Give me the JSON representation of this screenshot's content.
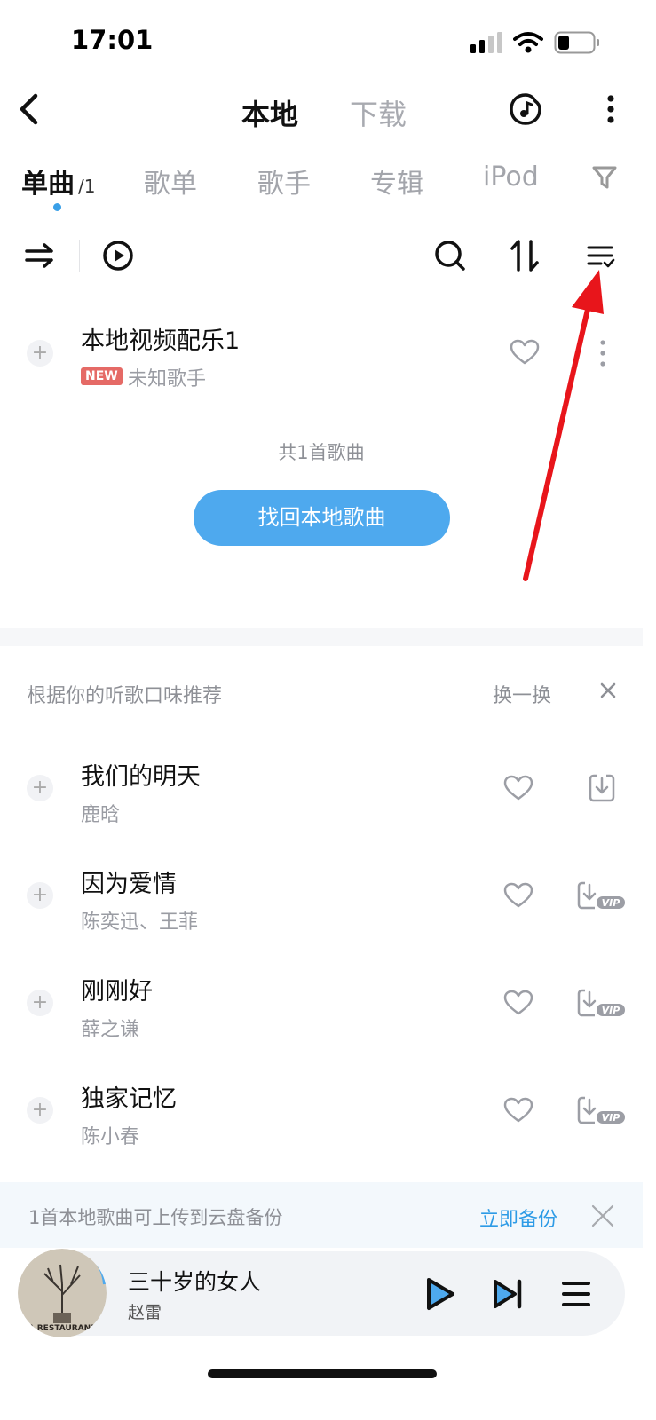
{
  "status_bar": {
    "time": "17:01"
  },
  "header": {
    "tab_local": "本地",
    "tab_download": "下载"
  },
  "tabs": {
    "songs": "单曲",
    "songs_count": "/1",
    "playlists": "歌单",
    "artists": "歌手",
    "albums": "专辑",
    "ipod": "iPod"
  },
  "local_songs": [
    {
      "title": "本地视频配乐1",
      "badge": "NEW",
      "artist": "未知歌手"
    }
  ],
  "total_count": "共1首歌曲",
  "recover_button": "找回本地歌曲",
  "recommend": {
    "title": "根据你的听歌口味推荐",
    "refresh": "换一换",
    "songs": [
      {
        "title": "我们的明天",
        "artist": "鹿晗",
        "download": "download-icon"
      },
      {
        "title": "因为爱情",
        "artist": "陈奕迅、王菲",
        "download": "vip-download-icon"
      },
      {
        "title": "刚刚好",
        "artist": "薛之谦",
        "download": "vip-download-icon"
      },
      {
        "title": "独家记忆",
        "artist": "陈小春",
        "download": "vip-download-icon"
      }
    ]
  },
  "backup": {
    "text": "1首本地歌曲可上传到云盘备份",
    "action": "立即备份"
  },
  "player": {
    "title": "三十岁的女人",
    "artist": "赵雷",
    "cover_text": "A RESTAURANT"
  },
  "colors": {
    "accent": "#2d9be6",
    "button": "#4ea9ee",
    "annotation_arrow": "#e8151b",
    "new_badge": "#e56a66"
  }
}
